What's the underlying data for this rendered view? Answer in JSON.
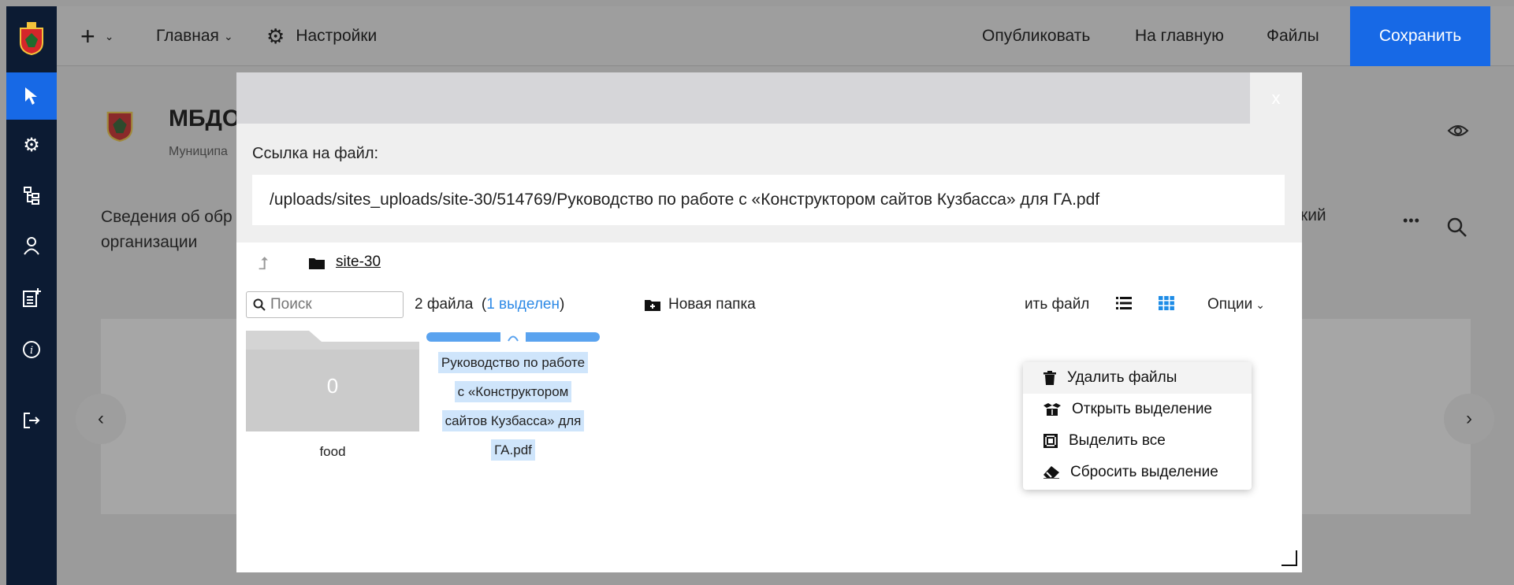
{
  "topbar": {
    "plus_label": "+",
    "home_label": "Главная",
    "settings_label": "Настройки",
    "publish_label": "Опубликовать",
    "to_home_label": "На главную",
    "files_label": "Файлы",
    "save_label": "Сохранить"
  },
  "background": {
    "site_title": "МБДО",
    "site_subtitle": "Муниципа",
    "nav_line1": "Сведения об обр",
    "nav_line2": "организации",
    "nav_right": "кий",
    "more_label": "•••"
  },
  "modal": {
    "close_label": "x",
    "link_label": "Ссылка на файл:",
    "link_value": "/uploads/sites_uploads/site-30/514769/Руководство по работе с «Конструктором сайтов Кузбасса» для ГА.pdf",
    "breadcrumb_folder": "site-30",
    "search_placeholder": "Поиск",
    "files_count_prefix": "2 файла  (",
    "files_selected": "1 выделен",
    "files_count_suffix": ")",
    "new_folder_label": "Новая папка",
    "upload_label": "ить файл",
    "options_label": "Опции",
    "files": [
      {
        "name": "food",
        "badge": "0"
      },
      {
        "name_lines": [
          "Руководство по работе",
          "с «Конструктором",
          "сайтов Кузбасса» для",
          "ГА.pdf"
        ]
      }
    ]
  },
  "context_menu": {
    "items": [
      {
        "label": "Удалить файлы",
        "icon": "trash-icon"
      },
      {
        "label": "Открыть выделение",
        "icon": "open-box-icon"
      },
      {
        "label": "Выделить все",
        "icon": "select-all-icon"
      },
      {
        "label": "Сбросить выделение",
        "icon": "eraser-icon"
      }
    ]
  },
  "colors": {
    "sidebar": "#0c1b33",
    "accent": "#1769e6",
    "selection": "#cfe5fb",
    "selected_text": "#2e8ae6"
  }
}
